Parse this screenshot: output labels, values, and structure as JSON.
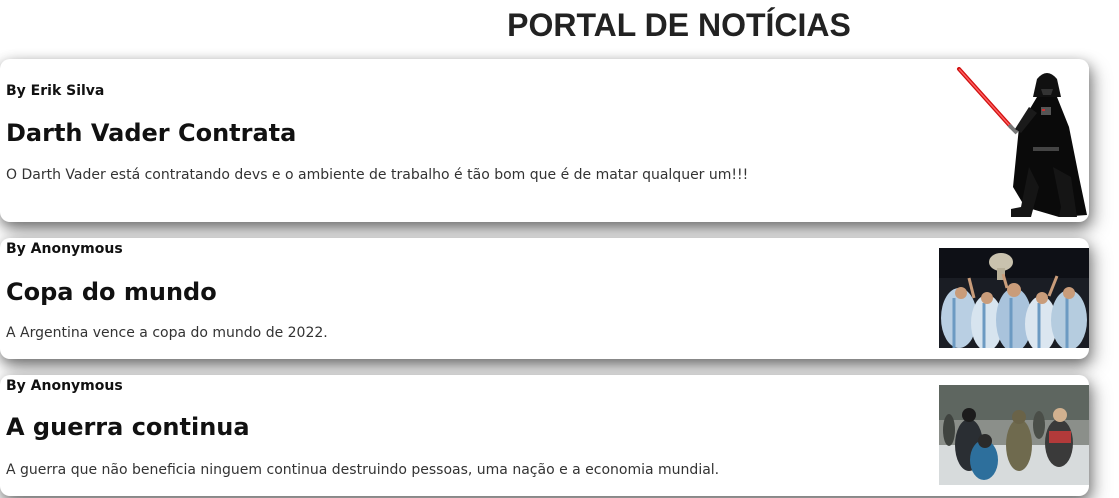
{
  "header": {
    "title": "PORTAL DE NOTÍCIAS"
  },
  "articles": [
    {
      "author": "By Erik Silva",
      "title": "Darth Vader Contrata",
      "summary": "O Darth Vader está contratando devs e o ambiente de trabalho é tão bom que é de matar qualquer um!!!",
      "image": "darth-vader-image"
    },
    {
      "author": "By Anonymous",
      "title": "Copa do mundo",
      "summary": "A Argentina vence a copa do mundo de 2022.",
      "image": "argentina-celebration-image"
    },
    {
      "author": "By Anonymous",
      "title": "A guerra continua",
      "summary": "A guerra que não beneficia ninguem continua destruindo pessoas, uma nação e a economia mundial.",
      "image": "war-photo-image"
    }
  ]
}
